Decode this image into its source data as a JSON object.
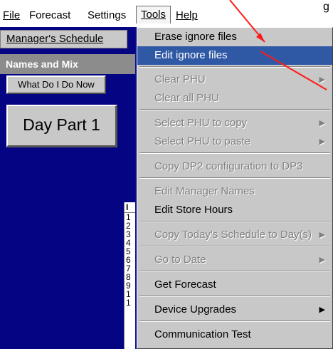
{
  "menubar": {
    "items": [
      "File",
      "Forecast",
      "Settings",
      "Tools",
      "Help"
    ]
  },
  "left_panel": {
    "tab_label": "Manager's Schedule",
    "section_label": "Names and Mix",
    "buttons": [
      "What Do I Do Now",
      "Day Part 1"
    ],
    "table_fragment": {
      "header": "I",
      "rows": [
        "1",
        "2",
        "3",
        "4",
        "5",
        "6",
        "7",
        "8",
        "9",
        "1",
        "1"
      ]
    }
  },
  "tools_menu": {
    "items": [
      {
        "label": "Erase ignore files",
        "state": "enabled",
        "submenu": false
      },
      {
        "label": "Edit ignore files",
        "state": "highlighted",
        "submenu": false
      },
      {
        "label": "Clear PHU",
        "state": "disabled",
        "submenu": true
      },
      {
        "label": "Clear all PHU",
        "state": "disabled",
        "submenu": false
      },
      {
        "label": "Select PHU to copy",
        "state": "disabled",
        "submenu": true
      },
      {
        "label": "Select PHU to paste",
        "state": "disabled",
        "submenu": true
      },
      {
        "label": "Copy DP2 configuration to DP3",
        "state": "disabled",
        "submenu": false
      },
      {
        "label": "Edit Manager Names",
        "state": "disabled",
        "submenu": false
      },
      {
        "label": "Edit Store Hours",
        "state": "enabled",
        "submenu": false
      },
      {
        "label": "Copy Today's Schedule to Day(s)",
        "state": "disabled",
        "submenu": true
      },
      {
        "label": "Go to Date",
        "state": "disabled",
        "submenu": true
      },
      {
        "label": "Get Forecast",
        "state": "enabled",
        "submenu": false
      },
      {
        "label": "Device Upgrades",
        "state": "enabled",
        "submenu": true
      },
      {
        "label": "Communication Test",
        "state": "enabled",
        "submenu": false
      }
    ]
  },
  "annotation": {
    "visible_text": "g",
    "color": "#ff1a1a"
  }
}
